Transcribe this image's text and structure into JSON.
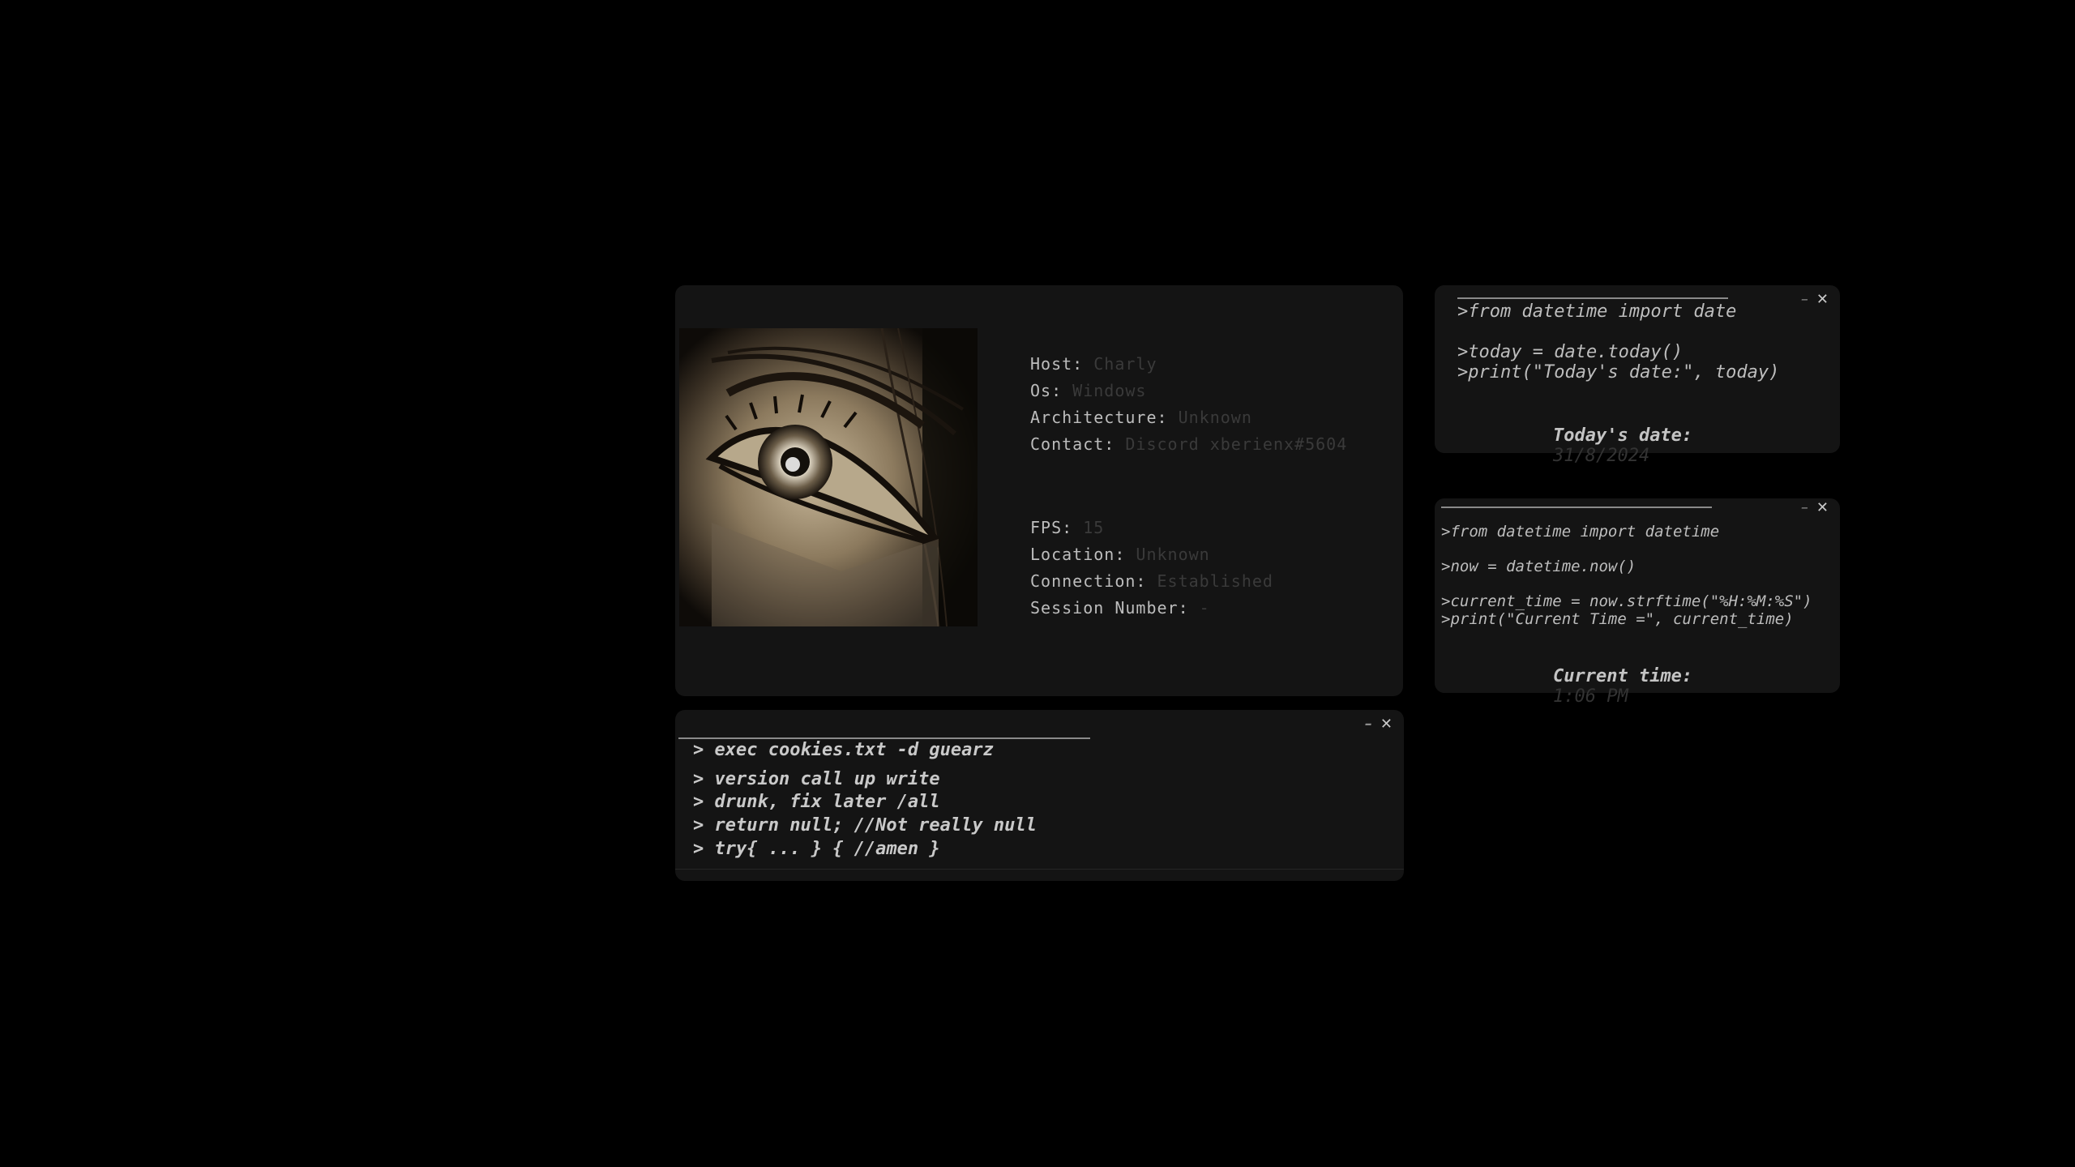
{
  "info": {
    "host_label": "Host:",
    "host_value": "Charly",
    "os_label": "Os:",
    "os_value": "Windows",
    "arch_label": "Architecture:",
    "arch_value": "Unknown",
    "contact_label": "Contact:",
    "contact_value": "Discord xberienx#5604",
    "fps_label": "FPS:",
    "fps_value": "15",
    "location_label": "Location:",
    "location_value": "Unknown",
    "connection_label": "Connection:",
    "connection_value": "Established",
    "session_label": "Session Number:",
    "session_value": "-"
  },
  "terminal": {
    "minimize": "–",
    "close": "✕",
    "lines": [
      "> exec cookies.txt -d guearz",
      "> version call up write",
      "> drunk, fix later /all",
      "> return null; //Not really null",
      "> try{ ... } { //amen }"
    ]
  },
  "date_window": {
    "minimize": "–",
    "close": "✕",
    "code": [
      ">from datetime import date",
      ">today = date.today()",
      ">print(\"Today's date:\", today)"
    ],
    "result_label": "Today's date:",
    "result_value": "31/8/2024"
  },
  "time_window": {
    "minimize": "–",
    "close": "✕",
    "code": [
      ">from datetime import datetime",
      ">now = datetime.now()",
      ">current_time = now.strftime(\"%H:%M:%S\")",
      ">print(\"Current Time =\", current_time)"
    ],
    "result_label": "Current time:",
    "result_value": "1:06 PM"
  },
  "colors": {
    "background": "#000000",
    "panel": "#141414",
    "text": "#bdbdbd",
    "muted_value": "#3a3a3a"
  }
}
